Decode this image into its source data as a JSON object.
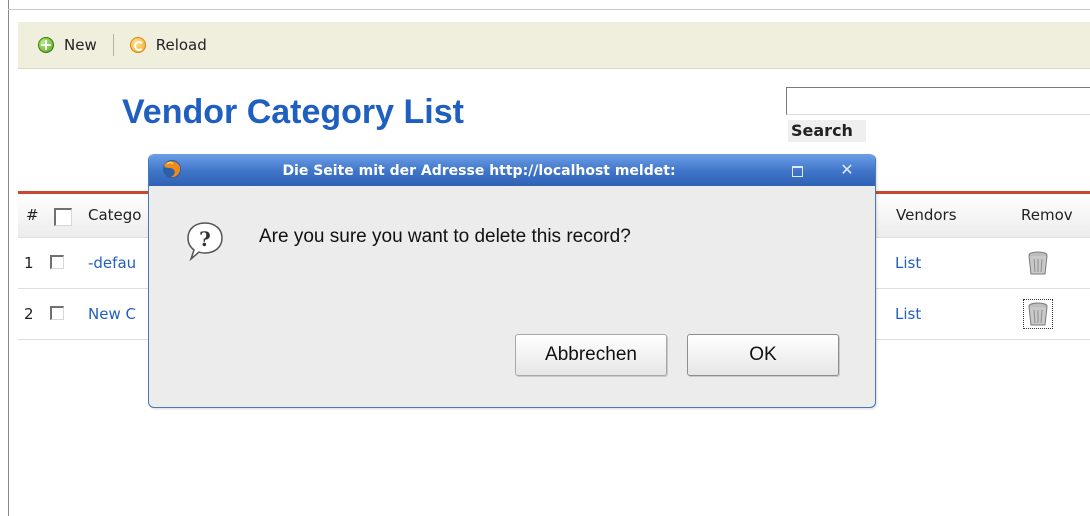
{
  "toolbar": {
    "new_label": "New",
    "reload_label": "Reload"
  },
  "page": {
    "title": "Vendor Category List"
  },
  "search": {
    "label": "Search",
    "value": ""
  },
  "table": {
    "columns": {
      "index": "#",
      "category": "Catego",
      "vendors": "Vendors",
      "remove": "Remov"
    },
    "rows": [
      {
        "index": "1",
        "category": "-defau",
        "vendors": "List"
      },
      {
        "index": "2",
        "category": "New C",
        "vendors": "List"
      }
    ]
  },
  "dialog": {
    "title": "Die Seite mit der Adresse http://localhost meldet:",
    "message": "Are you sure you want to delete this record?",
    "cancel_label": "Abbrechen",
    "ok_label": "OK",
    "close_glyph": "✕"
  },
  "colors": {
    "title_blue": "#1f5fbf",
    "table_accent": "#c9472c",
    "toolbar_bg": "#f0eedd",
    "dialog_titlebar": "#3f74c8"
  },
  "icons": {
    "new": "add-circle-icon",
    "reload": "reload-icon",
    "remove": "trash-can-icon",
    "dialog_app": "firefox-icon",
    "dialog_question": "question-bubble-icon"
  }
}
